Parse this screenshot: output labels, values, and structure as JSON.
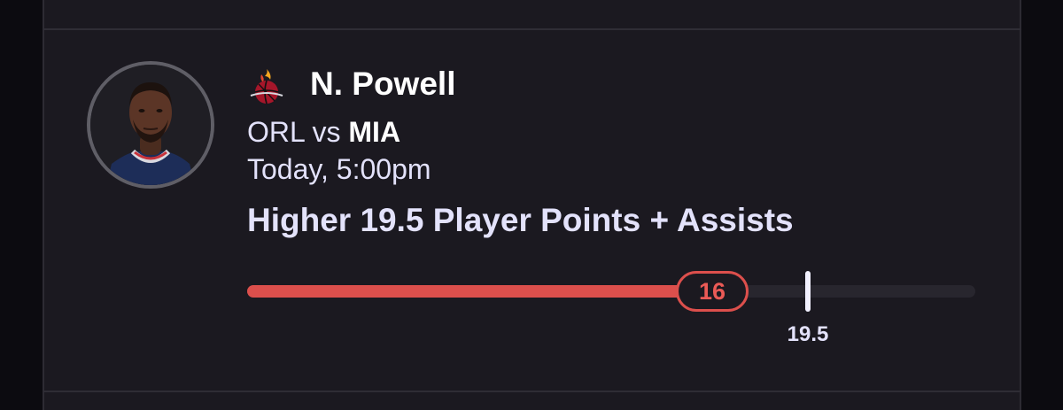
{
  "player": {
    "name": "N. Powell",
    "team_logo_icon": "miami-heat-logo-icon",
    "avatar": "player-headshot"
  },
  "game": {
    "away_team": "ORL",
    "separator": "vs",
    "home_team": "MIA",
    "time": "Today, 5:00pm"
  },
  "pick": {
    "text": "Higher 19.5 Player Points + Assists",
    "current_value": "16",
    "target_value": "19.5",
    "progress_fraction_of_track": 0.62
  },
  "colors": {
    "background": "#1b1920",
    "accent_red": "#dc4f4c",
    "text_primary": "#ffffff",
    "text_secondary": "#e3e2fb",
    "track": "#28262e"
  }
}
